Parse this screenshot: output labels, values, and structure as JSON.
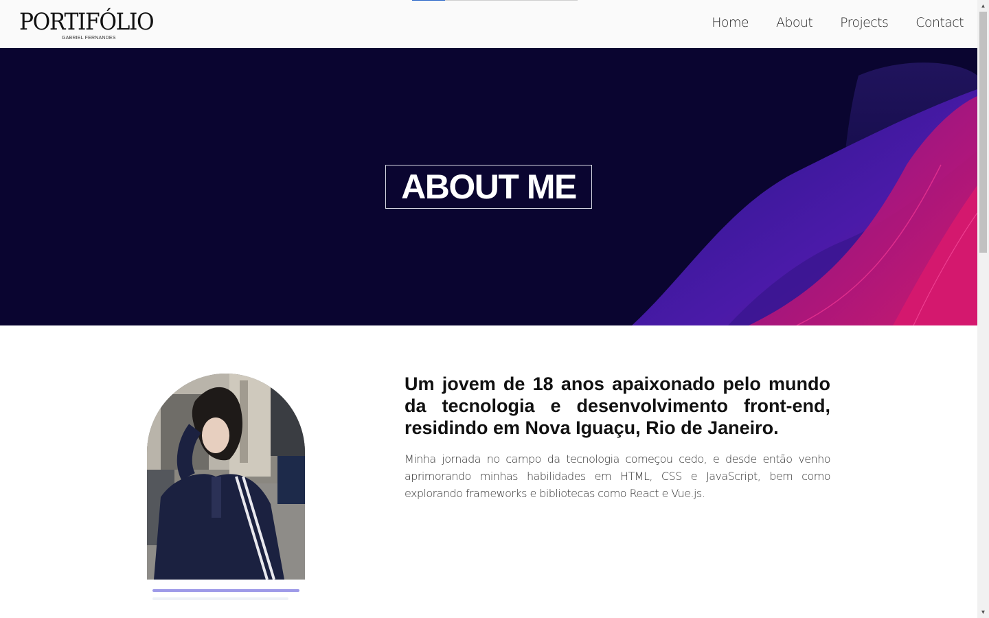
{
  "progress": {
    "value": 0.2,
    "accent": "#2b67c9"
  },
  "header": {
    "logo_title": "PORTIFÓLIO",
    "logo_subtitle": "GABRIEL FERNANDES",
    "nav": [
      {
        "label": "Home"
      },
      {
        "label": "About"
      },
      {
        "label": "Projects"
      },
      {
        "label": "Contact"
      }
    ]
  },
  "hero": {
    "title": "ABOUT ME",
    "colors": {
      "background": "#0a0530",
      "wave_purple": "#3b1aa6",
      "wave_pink": "#c0146a"
    }
  },
  "about": {
    "photo_icon": "profile-photo",
    "heading": "Um jovem de 18 anos apaixonado pelo mundo da tecnologia e desenvolvimento front-end, residindo em Nova Iguaçu, Rio de Janeiro.",
    "paragraph": "Minha jornada no campo da tecnologia começou cedo, e desde então venho aprimorando minhas habilidades em HTML, CSS e JavaScript, bem como explorando frameworks e bibliotecas como React e Vue.js."
  },
  "scrollbar": {
    "up_icon": "chevron-up-icon",
    "down_icon": "chevron-down-icon",
    "position": 0.0
  }
}
